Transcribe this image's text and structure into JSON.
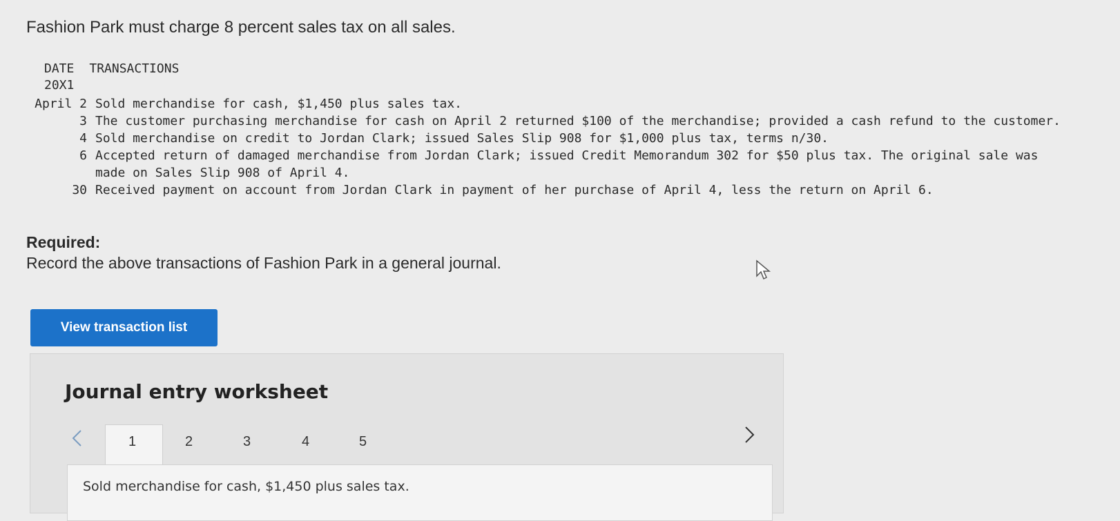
{
  "intro": "Fashion Park must charge 8 percent sales tax on all sales.",
  "table_header": {
    "date": "DATE",
    "transactions": "TRANSACTIONS"
  },
  "year": "20X1",
  "transactions": [
    {
      "date": "April 2",
      "text": "Sold merchandise for cash, $1,450 plus sales tax."
    },
    {
      "date": "3",
      "text": "The customer purchasing merchandise for cash on April 2 returned $100 of the merchandise; provided a cash refund to the customer."
    },
    {
      "date": "4",
      "text": "Sold merchandise on credit to Jordan Clark; issued Sales Slip 908 for $1,000 plus tax, terms n/30."
    },
    {
      "date": "6",
      "text": "Accepted return of damaged merchandise from Jordan Clark; issued Credit Memorandum 302 for $50 plus tax. The original sale was made on Sales Slip 908 of April 4."
    },
    {
      "date": "30",
      "text": "Received payment on account from Jordan Clark in payment of her purchase of April 4, less the return on April 6."
    }
  ],
  "required_label": "Required:",
  "required_text": "Record the above transactions of Fashion Park in a general journal.",
  "view_button_label": "View transaction list",
  "worksheet": {
    "title": "Journal entry worksheet",
    "tabs": [
      "1",
      "2",
      "3",
      "4",
      "5"
    ],
    "active_tab": "1",
    "entry_description": "Sold merchandise for cash, $1,450 plus sales tax."
  },
  "colors": {
    "button_bg": "#1c72c9",
    "page_bg": "#ececec",
    "panel_bg": "#f4f4f4"
  }
}
